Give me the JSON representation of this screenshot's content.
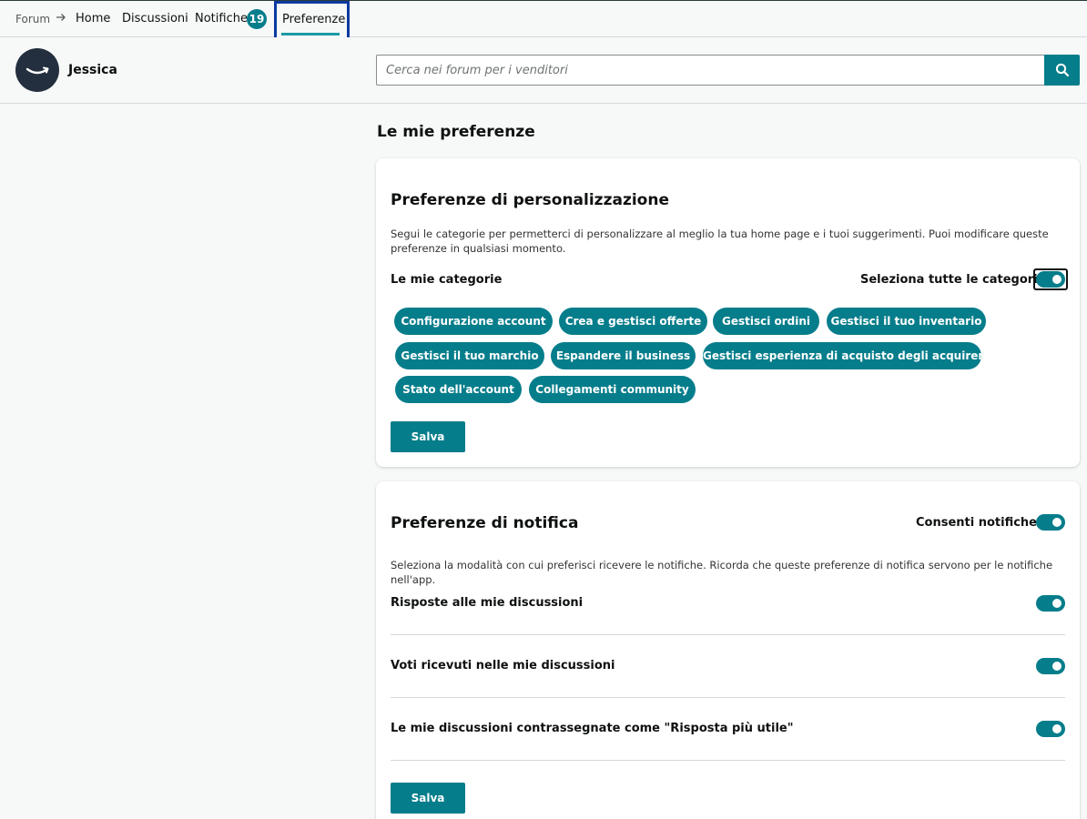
{
  "nav": {
    "forum_label": "Forum",
    "home_label": "Home",
    "discussions_label": "Discussioni",
    "notifications_label": "Notifiche",
    "notifications_count": "19",
    "preferences_label": "Preferenze"
  },
  "user": {
    "name": "Jessica"
  },
  "search": {
    "placeholder": "Cerca nei forum per i venditori",
    "value": ""
  },
  "page_title": "Le mie preferenze",
  "personalization": {
    "title": "Preferenze di personalizzazione",
    "description": "Segui le categorie per permetterci di personalizzare al meglio la tua home page e i tuoi suggerimenti. Puoi modificare queste preferenze in qualsiasi momento.",
    "categories_label": "Le mie categorie",
    "select_all_label": "Seleziona tutte le categorie",
    "select_all_on": true,
    "categories": [
      "Configurazione account",
      "Crea e gestisci offerte",
      "Gestisci ordini",
      "Gestisci il tuo inventario",
      "Gestisci il tuo marchio",
      "Espandere il business",
      "Gestisci esperienza di acquisto degli acquirenti",
      "Stato dell'account",
      "Collegamenti community"
    ],
    "save_label": "Salva"
  },
  "notifications": {
    "title": "Preferenze di notifica",
    "allow_label": "Consenti notifiche",
    "allow_on": true,
    "description": "Seleziona la modalità con cui preferisci ricevere le notifiche. Ricorda che queste preferenze di notifica servono per le notifiche nell'app.",
    "items": [
      {
        "label": "Risposte alle mie discussioni",
        "on": true
      },
      {
        "label": "Voti ricevuti nelle mie discussioni",
        "on": true
      },
      {
        "label": "Le mie discussioni contrassegnate come \"Risposta più utile\"",
        "on": true
      }
    ],
    "save_label": "Salva"
  },
  "colors": {
    "accent": "#067d8b",
    "focus_outline": "#0b3aa0",
    "avatar_bg": "#232f3e"
  }
}
